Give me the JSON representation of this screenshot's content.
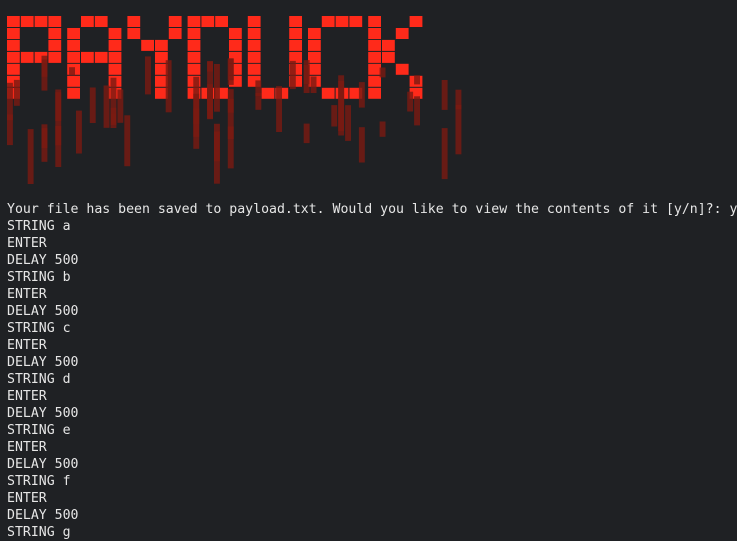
{
  "banner": {
    "logo_text": "PAYDUCK",
    "color": "#ff2a1a",
    "shade_color": "#7a1a12"
  },
  "prompt": {
    "text": "Your file has been saved to payload.txt. Would you like to view the contents of it [y/n]?: y"
  },
  "file_lines": [
    "STRING a",
    "ENTER",
    "DELAY 500",
    "STRING b",
    "ENTER",
    "DELAY 500",
    "STRING c",
    "ENTER",
    "DELAY 500",
    "STRING d",
    "ENTER",
    "DELAY 500",
    "STRING e",
    "ENTER",
    "DELAY 500",
    "STRING f",
    "ENTER",
    "DELAY 500",
    "STRING g"
  ]
}
